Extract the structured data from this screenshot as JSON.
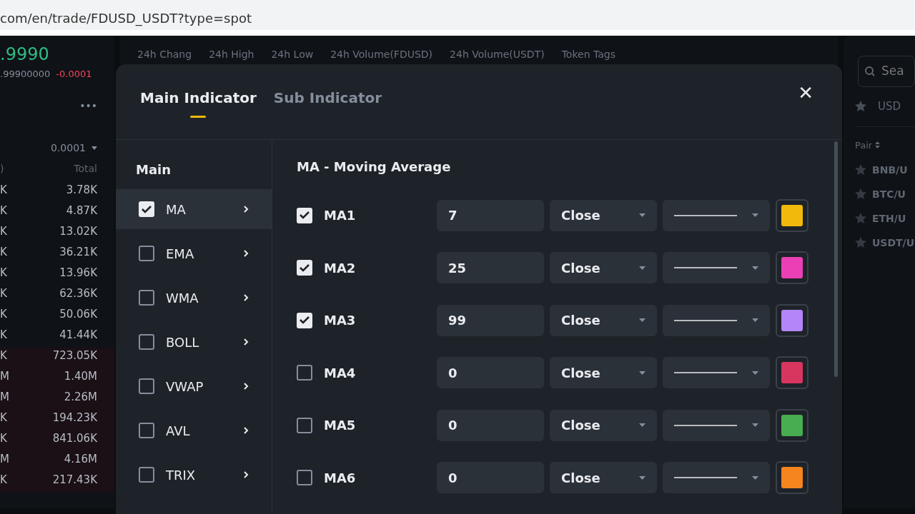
{
  "address_bar": {
    "url": "com/en/trade/FDUSD_USDT?type=spot"
  },
  "ticker": {
    "price": ".9990",
    "price_sub": ".99900000",
    "change": "-0.0001",
    "labels": [
      "24h Chang",
      "24h High",
      "24h Low",
      "24h Volume(FDUSD)",
      "24h Volume(USDT)",
      "Token Tags"
    ]
  },
  "order_book": {
    "more": "•••",
    "precision": "0.0001",
    "column_1": ")",
    "total_header": "Total",
    "rows": [
      {
        "column_1": "K",
        "total": "3.78K"
      },
      {
        "column_1": "K",
        "total": "4.87K"
      },
      {
        "column_1": "K",
        "total": "13.02K"
      },
      {
        "column_1": "K",
        "total": "36.21K"
      },
      {
        "column_1": "K",
        "total": "13.96K"
      },
      {
        "column_1": "K",
        "total": "62.36K"
      },
      {
        "column_1": "K",
        "total": "50.06K"
      },
      {
        "column_1": "K",
        "total": "41.44K"
      },
      {
        "column_1": "K",
        "total": "723.05K"
      },
      {
        "column_1": "M",
        "total": "1.40M"
      },
      {
        "column_1": "M",
        "total": "2.26M"
      },
      {
        "column_1": "K",
        "total": "194.23K"
      },
      {
        "column_1": "K",
        "total": "841.06K"
      },
      {
        "column_1": "M",
        "total": "4.16M"
      },
      {
        "column_1": "K",
        "total": "217.43K"
      }
    ]
  },
  "market_panel": {
    "search_placeholder": "Sea",
    "tab": "USD",
    "pair_header": "Pair",
    "pairs": [
      "BNB/U",
      "BTC/U",
      "ETH/U",
      "USDT/U"
    ]
  },
  "dialog": {
    "tabs": [
      {
        "label": "Main Indicator",
        "selected": true
      },
      {
        "label": "Sub Indicator",
        "selected": false
      }
    ],
    "close": "✕",
    "section": "Main",
    "indicators": [
      {
        "label": "MA",
        "checked": true,
        "selected": true
      },
      {
        "label": "EMA",
        "checked": false,
        "selected": false
      },
      {
        "label": "WMA",
        "checked": false,
        "selected": false
      },
      {
        "label": "BOLL",
        "checked": false,
        "selected": false
      },
      {
        "label": "VWAP",
        "checked": false,
        "selected": false
      },
      {
        "label": "AVL",
        "checked": false,
        "selected": false
      },
      {
        "label": "TRIX",
        "checked": false,
        "selected": false
      }
    ],
    "detail_title": "MA - Moving Average",
    "lines": [
      {
        "label": "MA1",
        "checked": true,
        "period": "7",
        "source": "Close",
        "color": "#f0b90b"
      },
      {
        "label": "MA2",
        "checked": true,
        "period": "25",
        "source": "Close",
        "color": "#eb40b5"
      },
      {
        "label": "MA3",
        "checked": true,
        "period": "99",
        "source": "Close",
        "color": "#b385f8"
      },
      {
        "label": "MA4",
        "checked": false,
        "period": "0",
        "source": "Close",
        "color": "#d8355f"
      },
      {
        "label": "MA5",
        "checked": false,
        "period": "0",
        "source": "Close",
        "color": "#48ad50"
      },
      {
        "label": "MA6",
        "checked": false,
        "period": "0",
        "source": "Close",
        "color": "#f6841f"
      }
    ]
  }
}
